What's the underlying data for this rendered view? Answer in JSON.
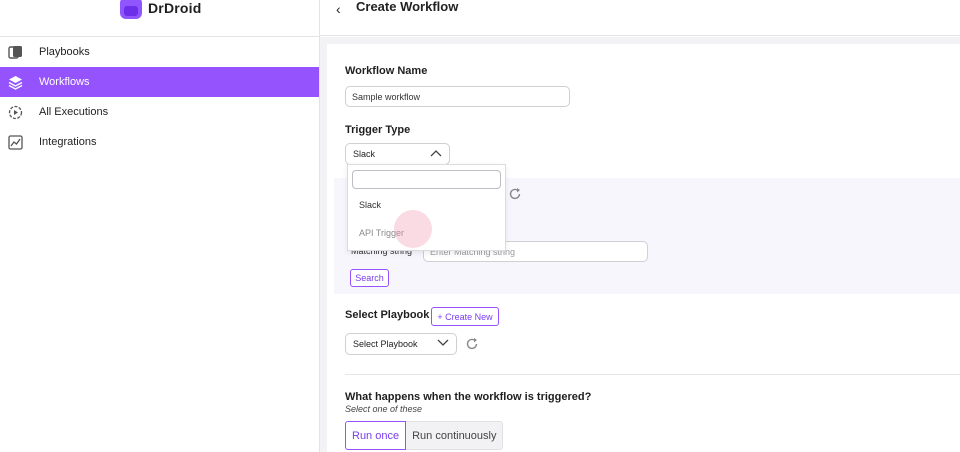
{
  "brand": {
    "name": "DrDroid"
  },
  "sidebar": {
    "items": [
      {
        "label": "Playbooks",
        "icon": "playbooks-icon",
        "active": false
      },
      {
        "label": "Workflows",
        "icon": "layers-icon",
        "active": true
      },
      {
        "label": "All Executions",
        "icon": "executions-icon",
        "active": false
      },
      {
        "label": "Integrations",
        "icon": "chart-icon",
        "active": false
      }
    ]
  },
  "header": {
    "back_glyph": "‹",
    "title": "Create Workflow"
  },
  "form": {
    "workflow_name_label": "Workflow Name",
    "workflow_name_value": "Sample workflow",
    "trigger_type_label": "Trigger Type",
    "trigger_type_value": "Slack",
    "trigger_dropdown": {
      "search_value": "",
      "options": [
        "Slack",
        "API Trigger"
      ]
    },
    "matching_string_label": "Matching string",
    "matching_string_placeholder": "Enter Matching string",
    "search_button": "Search",
    "select_playbook_label": "Select Playbook",
    "create_new_button": "+ Create New",
    "select_playbook_value": "Select Playbook",
    "triggered_question": "What happens when the workflow is triggered?",
    "triggered_hint": "Select one of these",
    "run_options": [
      {
        "label": "Run once",
        "selected": true
      },
      {
        "label": "Run continuously",
        "selected": false
      }
    ]
  },
  "colors": {
    "accent": "#9553fe",
    "accent_text": "#7a3df0"
  }
}
